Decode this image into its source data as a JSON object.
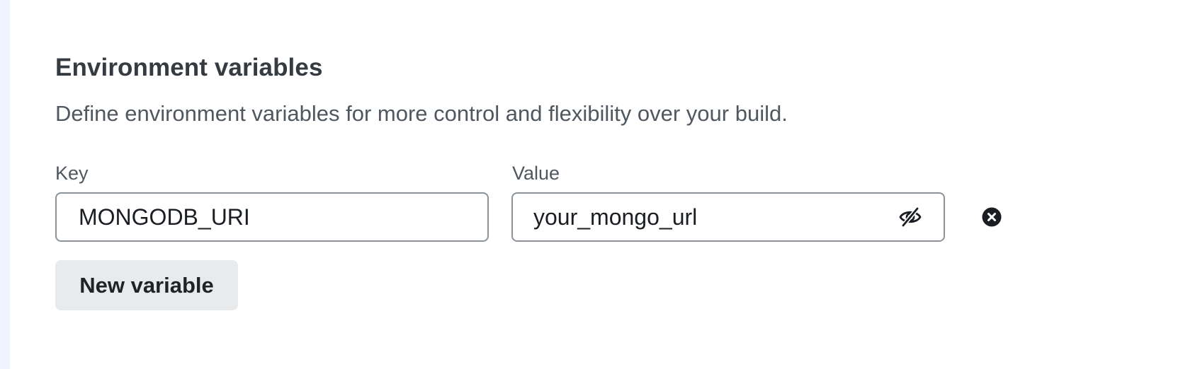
{
  "section": {
    "title": "Environment variables",
    "description": "Define environment variables for more control and flexibility over your build."
  },
  "labels": {
    "key": "Key",
    "value": "Value"
  },
  "variables": [
    {
      "key": "MONGODB_URI",
      "value": "your_mongo_url",
      "visibility_icon": "eye-off-icon",
      "remove_icon": "close-circle-icon"
    }
  ],
  "actions": {
    "new_variable_label": "New variable"
  },
  "colors": {
    "border": "#8c9298",
    "button_bg": "#e9eaec",
    "left_strip": "#eef4ff",
    "text_primary": "#363b41"
  }
}
